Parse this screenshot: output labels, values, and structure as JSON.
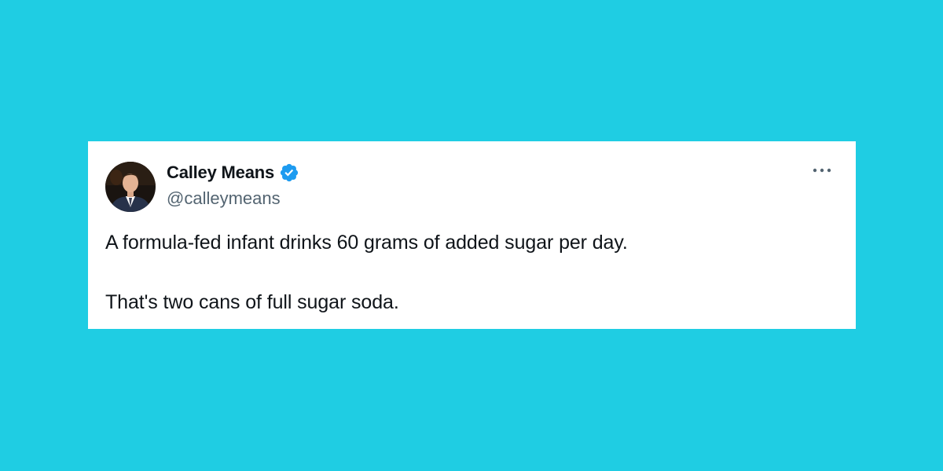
{
  "tweet": {
    "author": {
      "display_name": "Calley Means",
      "handle": "@calleymeans",
      "verified": true,
      "verified_icon": "verified-badge-icon",
      "avatar": "profile-photo"
    },
    "menu_icon": "more-options-icon",
    "text_lines": [
      "A formula-fed infant drinks 60 grams of added sugar per day.",
      "That's two cans of full sugar soda."
    ]
  },
  "colors": {
    "background": "#1fcde3",
    "card": "#ffffff",
    "text_primary": "#0f1419",
    "text_secondary": "#536471",
    "verified_blue": "#1d9bf0"
  }
}
